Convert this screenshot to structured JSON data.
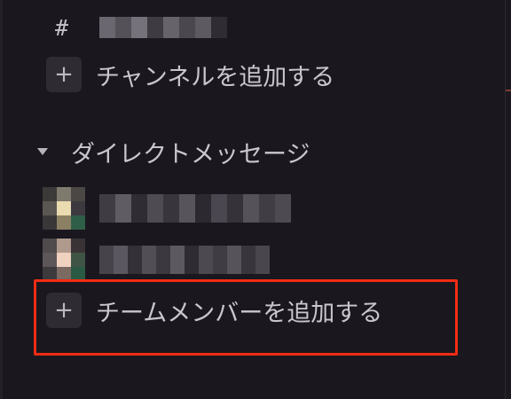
{
  "channels": {
    "items": [
      {
        "prefix": "#",
        "name_obscured": true
      }
    ],
    "add_label": "チャンネルを追加する"
  },
  "direct_messages": {
    "header": "ダイレクトメッセージ",
    "items": [
      {
        "name_obscured": true
      },
      {
        "name_obscured": true
      }
    ],
    "add_label": "チームメンバーを追加する"
  },
  "icons": {
    "channel": "hash-icon",
    "add": "plus-icon",
    "section_toggle": "caret-down-icon"
  },
  "colors": {
    "background": "#1a171e",
    "text": "#c9c6cd",
    "plus_box": "#2e2b33",
    "highlight": "#f32c14"
  }
}
